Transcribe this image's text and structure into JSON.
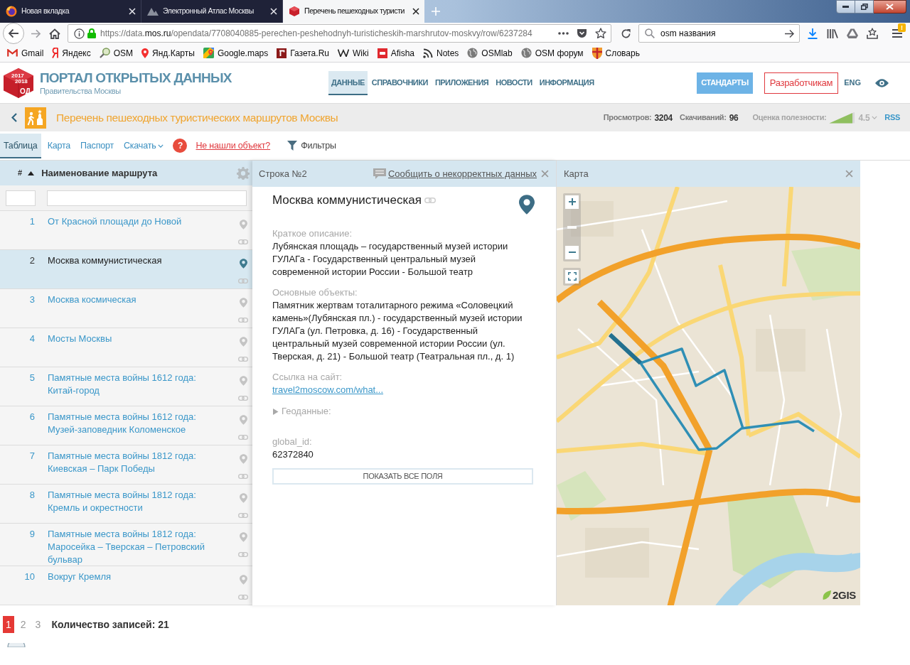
{
  "browser": {
    "tabs": [
      {
        "title": "Новая вкладка",
        "selected": false
      },
      {
        "title": "Электронный Атлас Москвы",
        "selected": false
      },
      {
        "title": "Перечень пешеходных туристи",
        "selected": true
      }
    ],
    "address": {
      "scheme": "https://data.",
      "domain": "mos.ru",
      "path": "/opendata/7708040885-perechen-peshehodnyh-turisticheskih-marshrutov-moskvy/row/6237284"
    },
    "search": {
      "value": "osm названия"
    },
    "menu_badge": "!",
    "bookmarks": [
      "Gmail",
      "Яндекс",
      "OSM",
      "Янд.Карты",
      "Google.maps",
      "Газета.Ru",
      "Wiki",
      "Afisha",
      "Notes",
      "OSMlab",
      "OSM форум",
      "Словарь"
    ]
  },
  "portal": {
    "logo": {
      "years": [
        "2017",
        "2018"
      ],
      "letters": "ОД"
    },
    "title": "ПОРТАЛ ОТКРЫТЫХ ДАННЫХ",
    "subtitle": "Правительства Москвы",
    "nav": [
      {
        "label": "ДАННЫЕ",
        "selected": true
      },
      {
        "label": "СПРАВОЧНИКИ",
        "selected": false
      },
      {
        "label": "ПРИЛОЖЕНИЯ",
        "selected": false
      },
      {
        "label": "НОВОСТИ",
        "selected": false
      },
      {
        "label": "ИНФОРМАЦИЯ",
        "selected": false
      }
    ],
    "standards": "СТАНДАРТЫ",
    "developers": "Разработчикам",
    "language": "ENG"
  },
  "dataset": {
    "title": "Перечень пешеходных туристических маршрутов Москвы",
    "stats": [
      {
        "label": "Просмотров:",
        "value": "3204"
      },
      {
        "label": "Скачиваний:",
        "value": "96"
      }
    ],
    "rating": {
      "label": "Оценка полезности:",
      "level": 0.9,
      "value": "4.5"
    },
    "rss": "RSS"
  },
  "view_tabs": [
    {
      "label": "Таблица",
      "selected": true,
      "dropdown": false
    },
    {
      "label": "Карта",
      "selected": false,
      "dropdown": false
    },
    {
      "label": "Паспорт",
      "selected": false,
      "dropdown": false
    },
    {
      "label": "Скачать",
      "selected": false,
      "dropdown": true
    }
  ],
  "help": "?",
  "not_found_link": "Не нашли объект?",
  "filters": "Фильтры",
  "table": {
    "columns": [
      "#",
      "Наименование маршрута"
    ],
    "sort_ascending": true,
    "rows": [
      {
        "number": "1",
        "name": "От Красной площади до Новой",
        "selected": false
      },
      {
        "number": "2",
        "name": "Москва коммунистическая",
        "selected": true
      },
      {
        "number": "3",
        "name": "Москва космическая",
        "selected": false
      },
      {
        "number": "4",
        "name": "Мосты Москвы",
        "selected": false
      },
      {
        "number": "5",
        "name": "Памятные места войны 1612 года: Китай-город",
        "selected": false
      },
      {
        "number": "6",
        "name": "Памятные места войны 1612 года: Музей-заповедник Коломенское",
        "selected": false
      },
      {
        "number": "7",
        "name": "Памятные места войны 1812 года: Киевская – Парк Победы",
        "selected": false
      },
      {
        "number": "8",
        "name": "Памятные места войны 1812 года: Кремль и окрестности",
        "selected": false
      },
      {
        "number": "9",
        "name": "Памятные места войны 1812 года: Маросейка – Тверская – Петровский бульвар",
        "selected": false
      },
      {
        "number": "10",
        "name": "Вокруг Кремля",
        "selected": false
      }
    ]
  },
  "detail": {
    "header": "Строка №2",
    "report_link": "Сообщить о некорректных данных",
    "title": "Москва коммунистическая",
    "fields": [
      {
        "kind": "text",
        "label": "Краткое описание:",
        "value": "Лубянская площадь – государственный музей истории ГУЛАГа - Государственный центральный музей современной истории России - Большой театр"
      },
      {
        "kind": "text",
        "label": "Основные объекты:",
        "value": "Памятник жертвам тоталитарного режима «Соловецкий камень»(Лубянская пл.) - государственный музей истории ГУЛАГа (ул. Петровка, д. 16) - Государственный центральный музей современной истории России (ул. Тверская, д. 21) - Большой театр (Театральная пл., д. 1)"
      },
      {
        "kind": "link",
        "label": "Ссылка на сайт:",
        "value": "travel2moscow.com/what..."
      },
      {
        "kind": "section",
        "label": "Геоданные:",
        "expanded": false
      },
      {
        "kind": "text",
        "label": "global_id:",
        "value": "62372840"
      }
    ],
    "show_all": "ПОКАЗАТЬ ВСЕ ПОЛЯ"
  },
  "map": {
    "header": "Карта",
    "zoom": {
      "level": 0.5
    },
    "attribution": "2GIS"
  },
  "pagination": {
    "pages": [
      {
        "label": "1",
        "selected": true
      },
      {
        "label": "2",
        "selected": false
      },
      {
        "label": "3",
        "selected": false
      }
    ],
    "total": "Количество записей: 21"
  }
}
